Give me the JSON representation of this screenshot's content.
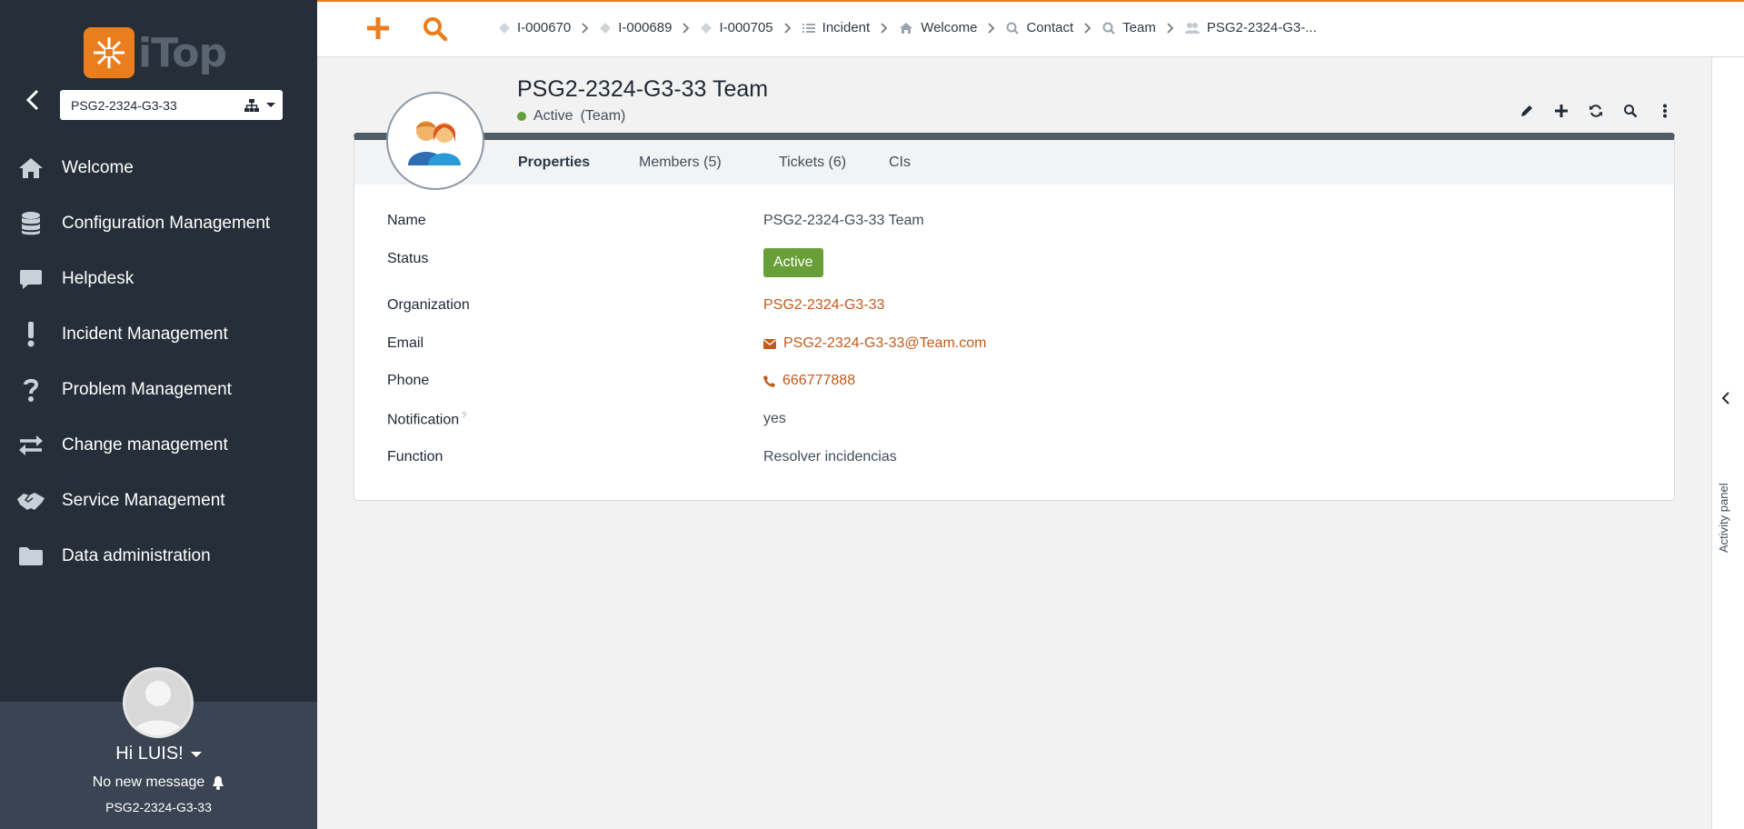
{
  "sidebar": {
    "logo_text": "iTop",
    "org_selector": {
      "value": "PSG2-2324-G3-33"
    },
    "menu": [
      {
        "label": "Welcome",
        "icon": "home-icon"
      },
      {
        "label": "Configuration Management",
        "icon": "database-icon"
      },
      {
        "label": "Helpdesk",
        "icon": "comment-icon"
      },
      {
        "label": "Incident Management",
        "icon": "exclamation-icon"
      },
      {
        "label": "Problem Management",
        "icon": "question-icon"
      },
      {
        "label": "Change management",
        "icon": "exchange-icon"
      },
      {
        "label": "Service Management",
        "icon": "handshake-icon"
      },
      {
        "label": "Data administration",
        "icon": "folder-icon"
      }
    ],
    "user": {
      "greeting": "Hi LUIS!",
      "messages": "No new message",
      "organization": "PSG2-2324-G3-33"
    }
  },
  "breadcrumb": [
    {
      "label": "I-000670",
      "icon": "ticket-icon"
    },
    {
      "label": "I-000689",
      "icon": "ticket-icon"
    },
    {
      "label": "I-000705",
      "icon": "ticket-icon"
    },
    {
      "label": "Incident",
      "icon": "list-icon"
    },
    {
      "label": "Welcome",
      "icon": "home-icon"
    },
    {
      "label": "Contact",
      "icon": "search-icon"
    },
    {
      "label": "Team",
      "icon": "search-icon"
    },
    {
      "label": "PSG2-2324-G3-...",
      "icon": "team-icon"
    }
  ],
  "object": {
    "title": "PSG2-2324-G3-33 Team",
    "status": "Active",
    "class": "(Team)"
  },
  "tabs": [
    {
      "label": "Properties",
      "active": true
    },
    {
      "label": "Members (5)",
      "active": false
    },
    {
      "label": "Tickets (6)",
      "active": false
    },
    {
      "label": "CIs",
      "active": false
    }
  ],
  "fields": {
    "name": {
      "label": "Name",
      "value": "PSG2-2324-G3-33 Team"
    },
    "status": {
      "label": "Status",
      "value": "Active"
    },
    "organization": {
      "label": "Organization",
      "value": "PSG2-2324-G3-33"
    },
    "email": {
      "label": "Email",
      "value": "PSG2-2324-G3-33@Team.com"
    },
    "phone": {
      "label": "Phone",
      "value": "666777888"
    },
    "notification": {
      "label": "Notification",
      "value": "yes",
      "hint": "?"
    },
    "function": {
      "label": "Function",
      "value": "Resolver incidencias"
    }
  },
  "activity_panel": {
    "label": "Activity panel"
  },
  "colors": {
    "accent": "#ea7d1e",
    "link": "#c15b1b",
    "active_green": "#689f38",
    "sidebar_bg": "#262f39"
  }
}
